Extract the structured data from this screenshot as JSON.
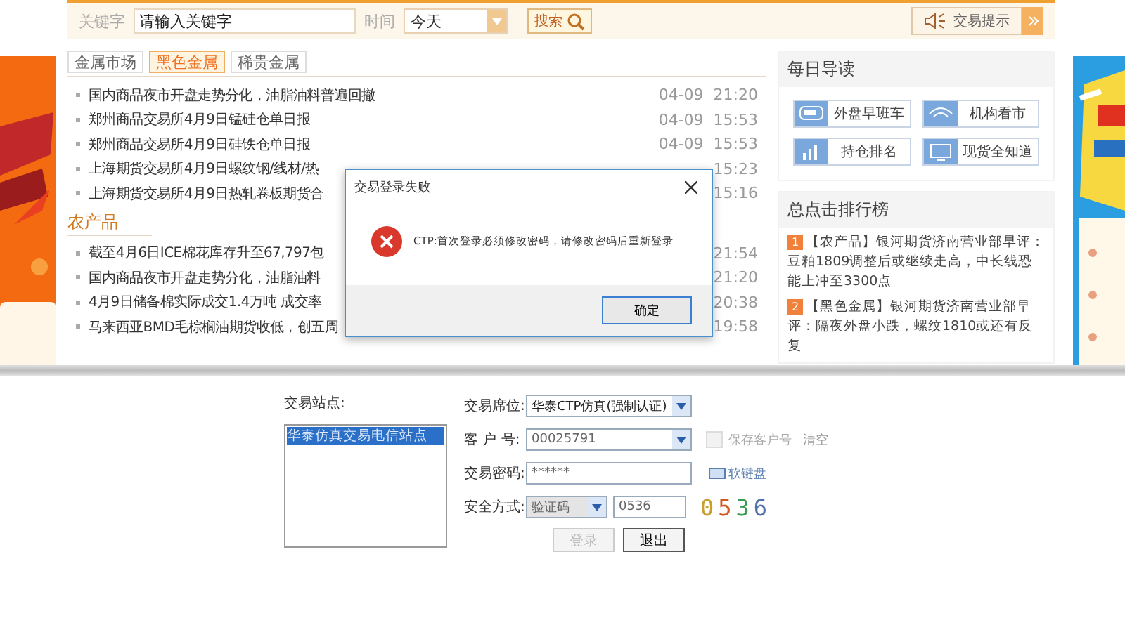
{
  "search_bar": {
    "keyword_label": "关键字",
    "keyword_placeholder": "请输入关键字",
    "time_label": "时间",
    "time_value": "今天",
    "search_button": "搜索",
    "notice_button": "交易提示"
  },
  "market_tabs": [
    {
      "label": "金属市场",
      "selected": false
    },
    {
      "label": "黑色金属",
      "selected": true
    },
    {
      "label": "稀贵金属",
      "selected": false
    }
  ],
  "metal_news": [
    {
      "title": "国内商品夜市开盘走势分化，油脂油料普遍回撤",
      "time": "04-09  21:20"
    },
    {
      "title": "郑州商品交易所4月9日锰硅仓单日报",
      "time": "04-09  15:53"
    },
    {
      "title": "郑州商品交易所4月9日硅铁仓单日报",
      "time": "04-09  15:53"
    },
    {
      "title": "上海期货交易所4月9日螺纹钢/线材/热",
      "time": "15:23"
    },
    {
      "title": "上海期货交易所4月9日热轧卷板期货合",
      "time": "15:16"
    }
  ],
  "agri_heading": "农产品",
  "agri_news": [
    {
      "title": "截至4月6日ICE棉花库存升至67,797包",
      "time": "21:54"
    },
    {
      "title": "国内商品夜市开盘走势分化，油脂油料",
      "time": "21:20"
    },
    {
      "title": "4月9日储备棉实际成交1.4万吨 成交率",
      "time": "20:38"
    },
    {
      "title": "马来西亚BMD毛棕榈油期货收低，创五周",
      "time": "19:58"
    }
  ],
  "daily_guide": {
    "title": "每日导读",
    "buttons": [
      {
        "label": "外盘早班车",
        "kind": "car"
      },
      {
        "label": "机构看市",
        "kind": "eye"
      },
      {
        "label": "持仓排名",
        "kind": "bars"
      },
      {
        "label": "现货全知道",
        "kind": "screen"
      }
    ]
  },
  "ranking": {
    "title": "总点击排行榜",
    "items": [
      {
        "rank": "1",
        "text": "【农产品】银河期货济南营业部早评：豆粕1809调整后或继续走高，中长线恐能上冲至3300点"
      },
      {
        "rank": "2",
        "text": "【黑色金属】银河期货济南营业部早评：隔夜外盘小跌，螺纹1810或还有反复"
      }
    ]
  },
  "dialog": {
    "title": "交易登录失败",
    "message": "CTP:首次登录必须修改密码，请修改密码后重新登录",
    "ok_button": "确定"
  },
  "login": {
    "site_label": "交易站点:",
    "sites": [
      {
        "label": "华泰仿真交易电信站点",
        "selected": true
      }
    ],
    "seat_label": "交易席位:",
    "seat_value": "华泰CTP仿真(强制认证)",
    "account_label": "客 户 号:",
    "account_value": "00025791",
    "save_account": {
      "label": "保存客户号",
      "checked": false,
      "disabled": true
    },
    "clear_link": "清空",
    "password_label": "交易密码:",
    "password_value": "******",
    "keyboard_link": "软键盘",
    "security_label": "安全方式:",
    "security_value": "验证码",
    "code_value": "0536",
    "captcha": "0536",
    "login_button": {
      "label": "登录",
      "disabled": true
    },
    "exit_button": "退出"
  }
}
